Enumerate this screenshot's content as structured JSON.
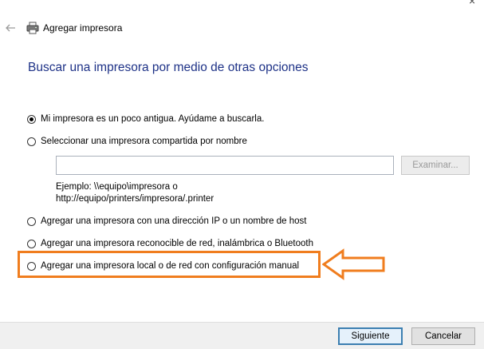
{
  "window": {
    "title": "Agregar impresora",
    "close_glyph": "×"
  },
  "heading": "Buscar una impresora por medio de otras opciones",
  "options": [
    {
      "label": "Mi impresora es un poco antigua. Ayúdame a buscarla.",
      "selected": true
    },
    {
      "label": "Seleccionar una impresora compartida por nombre",
      "selected": false
    },
    {
      "label": "Agregar una impresora con una dirección IP o un nombre de host",
      "selected": false
    },
    {
      "label": "Agregar una impresora reconocible de red, inalámbrica o Bluetooth",
      "selected": false
    },
    {
      "label": "Agregar una impresora local o de red con configuración manual",
      "selected": false
    }
  ],
  "share": {
    "value": "",
    "browse_label": "Examinar..."
  },
  "example": {
    "line1": "Ejemplo: \\\\equipo\\impresora o",
    "line2": "http://equipo/printers/impresora/.printer"
  },
  "footer": {
    "next_label": "Siguiente",
    "cancel_label": "Cancelar"
  },
  "colors": {
    "heading": "#1e3287",
    "highlight": "#f07d1e",
    "primary_border": "#3c7fb1"
  },
  "icons": [
    "back-arrow-icon",
    "printer-icon",
    "close-icon",
    "pointer-arrow-icon"
  ]
}
